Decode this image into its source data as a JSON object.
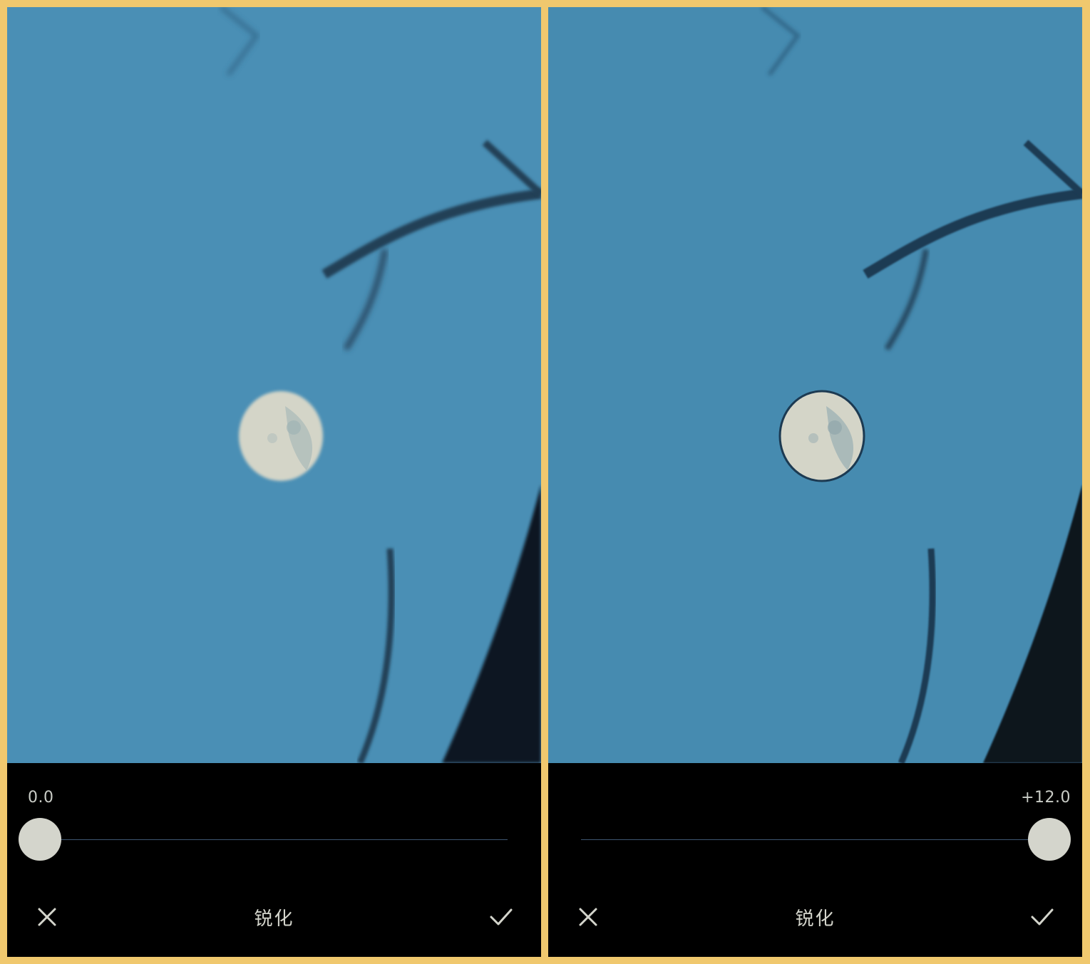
{
  "panels": [
    {
      "id": "before",
      "slider": {
        "value_label": "0.0",
        "value": 0.0,
        "min": 0,
        "max": 12,
        "fraction": 0.0
      },
      "tool_name": "锐化"
    },
    {
      "id": "after",
      "slider": {
        "value_label": "+12.0",
        "value": 12.0,
        "min": 0,
        "max": 12,
        "fraction": 1.0
      },
      "tool_name": "锐化"
    }
  ],
  "icons": {
    "cancel": "close-icon",
    "confirm": "checkmark-icon"
  },
  "colors": {
    "sky": "#4a8fb5",
    "moon": "#d4d5c8",
    "branch": "#1c3a52",
    "frame": "#f0c86e",
    "toolbar": "#000000"
  }
}
